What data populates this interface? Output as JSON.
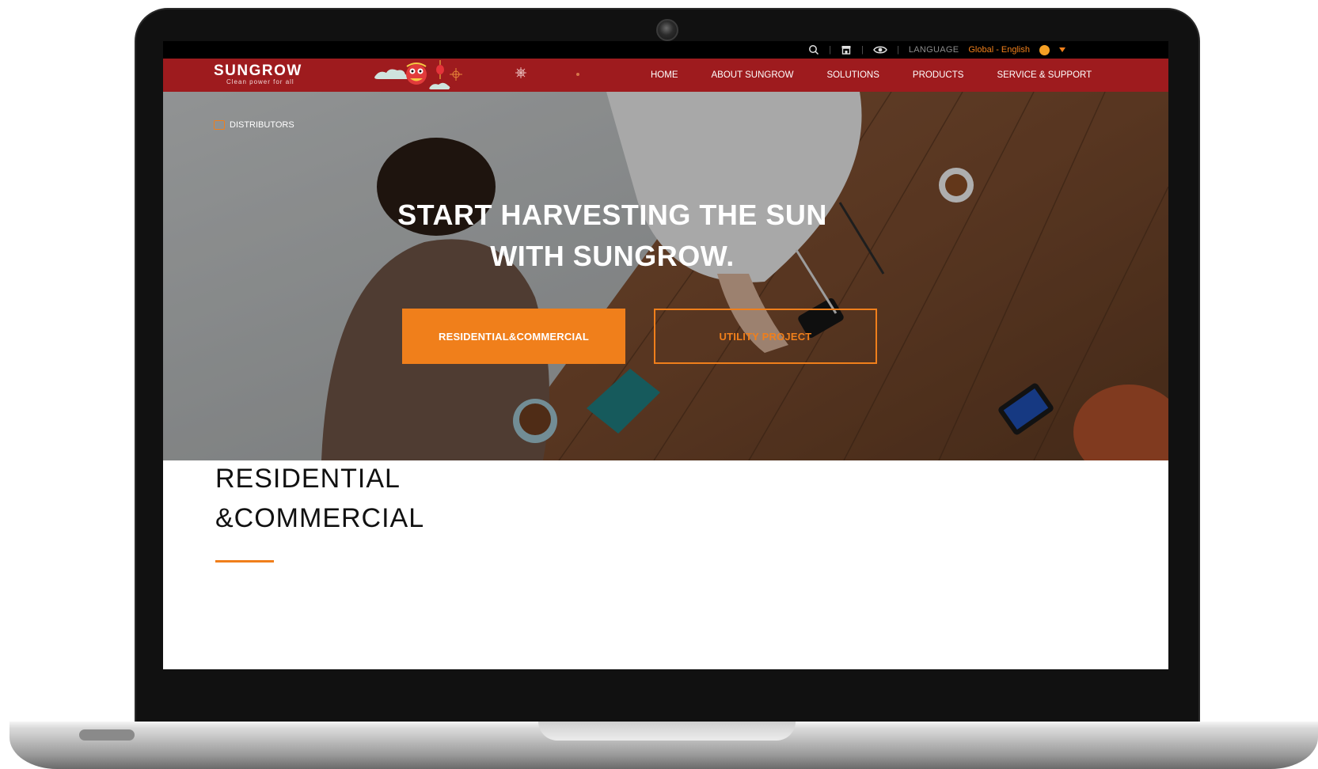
{
  "utility_bar": {
    "icons": [
      "search-icon",
      "store-icon",
      "eye-icon"
    ],
    "language_label": "LANGUAGE",
    "language_value": "Global - English"
  },
  "nav": {
    "logo_text": "SUNGROW",
    "logo_tagline": "Clean power for all",
    "items": [
      {
        "label": "HOME"
      },
      {
        "label": "ABOUT SUNGROW"
      },
      {
        "label": "SOLUTIONS"
      },
      {
        "label": "PRODUCTS"
      },
      {
        "label": "SERVICE & SUPPORT"
      }
    ]
  },
  "hero": {
    "breadcrumb": "DISTRIBUTORS",
    "title_line1": "START HARVESTING THE SUN",
    "title_line2": "WITH SUNGROW.",
    "primary_button": "RESIDENTIAL&COMMERCIAL",
    "secondary_button": "UTILITY PROJECT"
  },
  "section": {
    "title_line1": "RESIDENTIAL",
    "title_line2": "&COMMERCIAL"
  },
  "colors": {
    "brand_red": "#9e1b1e",
    "accent_orange": "#f07f1b",
    "utility_black": "#000000"
  }
}
